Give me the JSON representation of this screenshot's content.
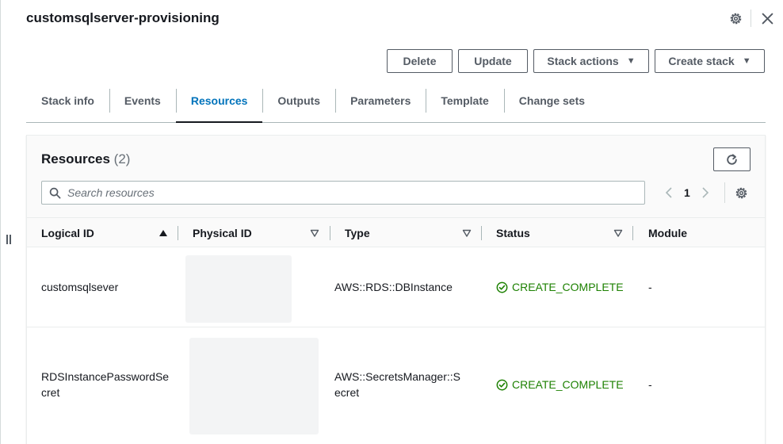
{
  "stack": {
    "title": "customsqlserver-provisioning"
  },
  "header_icons": [
    "gear-icon",
    "close-icon"
  ],
  "actions": {
    "delete": "Delete",
    "update": "Update",
    "stack_actions": "Stack actions",
    "create_stack": "Create stack"
  },
  "tabs": [
    {
      "label": "Stack info",
      "active": false
    },
    {
      "label": "Events",
      "active": false
    },
    {
      "label": "Resources",
      "active": true
    },
    {
      "label": "Outputs",
      "active": false
    },
    {
      "label": "Parameters",
      "active": false
    },
    {
      "label": "Template",
      "active": false
    },
    {
      "label": "Change sets",
      "active": false
    }
  ],
  "resources": {
    "title": "Resources",
    "count": "(2)",
    "search_placeholder": "Search resources",
    "page": "1",
    "columns": {
      "logical_id": "Logical ID",
      "physical_id": "Physical ID",
      "type": "Type",
      "status": "Status",
      "module": "Module"
    },
    "rows": [
      {
        "logical_id": "customsqlsever",
        "physical_id": "",
        "type": "AWS::RDS::DBInstance",
        "status": "CREATE_COMPLETE",
        "module": "-"
      },
      {
        "logical_id_line1": "RDSInstancePasswordSe",
        "logical_id_line2": "cret",
        "physical_id": "",
        "type_line1": "AWS::SecretsManager::S",
        "type_line2": "ecret",
        "status": "CREATE_COMPLETE",
        "module": "-"
      }
    ]
  },
  "colors": {
    "link_blue": "#0073bb",
    "success_green": "#1d8102",
    "text_dark": "#16191f",
    "text_grey": "#545b64"
  }
}
